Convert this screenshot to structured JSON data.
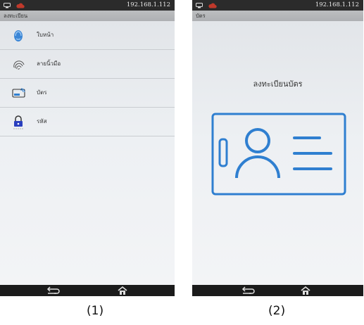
{
  "screens": [
    {
      "status_ip": "192.168.1.112",
      "title": "ลงทะเบียน",
      "menu_items": [
        {
          "label": "ใบหน้า",
          "icon": "face-icon"
        },
        {
          "label": "ลายนิ้วมือ",
          "icon": "fingerprint-icon"
        },
        {
          "label": "บัตร",
          "icon": "card-icon"
        },
        {
          "label": "รหัส",
          "icon": "password-lock-icon"
        }
      ],
      "caption": "(1)"
    },
    {
      "status_ip": "192.168.1.112",
      "title": "บัตร",
      "heading": "ลงทะเบียนบัตร",
      "caption": "(2)"
    }
  ],
  "colors": {
    "accent_blue": "#2f7fd0",
    "statusbar": "#2b2b2b",
    "titlebar": "#b3b5b8",
    "navbar": "#1b1b1b",
    "lock_accent": "#2a3fbf"
  }
}
